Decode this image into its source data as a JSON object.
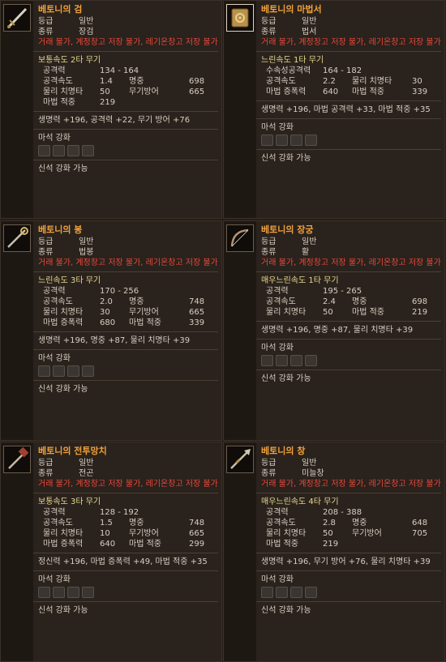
{
  "restriction_text": "거래 불가, 계정창고 저장 불가, 레기온창고 저장 불가",
  "label_grade": "등급",
  "label_type": "종류",
  "upgrade_title": "마석 강화",
  "divine_text": "신석 강화 가능",
  "cards": [
    {
      "title": "베토니의 검",
      "grade": "일반",
      "type": "장검",
      "speed": "보통속도 2타 무기",
      "stats": [
        {
          "k": "공격력",
          "v": "134 - 164"
        },
        {
          "k": "공격속도",
          "v": "1.4",
          "k2": "명중",
          "v2": "698"
        },
        {
          "k": "물리 치명타",
          "v": "50",
          "k2": "무기방어",
          "v2": "665"
        },
        {
          "k": "마법 적중",
          "v": "219"
        }
      ],
      "bonus": "생명력 +196, 공격력 +22, 무기 방어 +76",
      "icon": "sword-icon"
    },
    {
      "title": "베토니의 마법서",
      "grade": "일반",
      "type": "법서",
      "speed": "느린속도 1타 무기",
      "stats": [
        {
          "k": "수속성공격력",
          "v": "164 - 182"
        },
        {
          "k": "공격속도",
          "v": "2.2",
          "k2": "물리 치명타",
          "v2": "30"
        },
        {
          "k": "마법 증폭력",
          "v": "640",
          "k2": "마법 적중",
          "v2": "339"
        }
      ],
      "bonus": "생명력 +196, 마법 공격력 +33, 마법 적중 +35",
      "icon": "spellbook-icon"
    },
    {
      "title": "베토니의 봉",
      "grade": "일반",
      "type": "법봉",
      "speed": "느린속도 3타 무기",
      "stats": [
        {
          "k": "공격력",
          "v": "170 - 256"
        },
        {
          "k": "공격속도",
          "v": "2.0",
          "k2": "명중",
          "v2": "748"
        },
        {
          "k": "물리 치명타",
          "v": "30",
          "k2": "무기방어",
          "v2": "665"
        },
        {
          "k": "마법 증폭력",
          "v": "680",
          "k2": "마법 적중",
          "v2": "339"
        }
      ],
      "bonus": "생명력 +196, 명중 +87, 물리 치명타 +39",
      "icon": "staff-icon"
    },
    {
      "title": "베토니의 장궁",
      "grade": "일반",
      "type": "활",
      "speed": "매우느린속도 1타 무기",
      "stats": [
        {
          "k": "공격력",
          "v": "195 - 265"
        },
        {
          "k": "공격속도",
          "v": "2.4",
          "k2": "명중",
          "v2": "698"
        },
        {
          "k": "물리 치명타",
          "v": "50",
          "k2": "마법 적중",
          "v2": "219"
        }
      ],
      "bonus": "생명력 +196, 명중 +87, 물리 치명타 +39",
      "icon": "longbow-icon"
    },
    {
      "title": "베토니의 전투망치",
      "grade": "일반",
      "type": "전곤",
      "speed": "보통속도 3타 무기",
      "stats": [
        {
          "k": "공격력",
          "v": "128 - 192"
        },
        {
          "k": "공격속도",
          "v": "1.5",
          "k2": "명중",
          "v2": "748"
        },
        {
          "k": "물리 치명타",
          "v": "10",
          "k2": "무기방어",
          "v2": "665"
        },
        {
          "k": "마법 증폭력",
          "v": "640",
          "k2": "마법 적중",
          "v2": "299"
        }
      ],
      "bonus": "정신력 +196, 마법 증폭력 +49, 마법 적중 +35",
      "icon": "warhammer-icon"
    },
    {
      "title": "베토니의 창",
      "grade": "일반",
      "type": "미늘창",
      "speed": "매우느린속도 4타 무기",
      "stats": [
        {
          "k": "공격력",
          "v": "208 - 388"
        },
        {
          "k": "공격속도",
          "v": "2.8",
          "k2": "명중",
          "v2": "648"
        },
        {
          "k": "물리 치명타",
          "v": "50",
          "k2": "무기방어",
          "v2": "705"
        },
        {
          "k": "마법 적중",
          "v": "219"
        }
      ],
      "bonus": "생명력 +196, 무기 방어 +76, 물리 치명타 +39",
      "icon": "polearm-icon"
    }
  ]
}
